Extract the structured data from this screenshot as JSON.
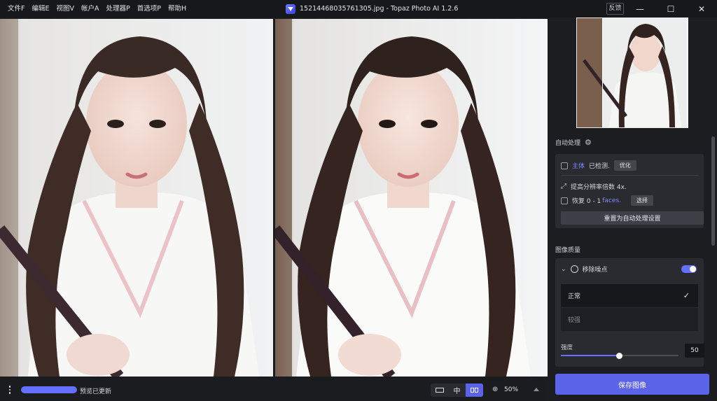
{
  "menu": [
    "文件F",
    "编辑E",
    "视图V",
    "帐户A",
    "处理器P",
    "首选项P",
    "帮助H"
  ],
  "window": {
    "title": "15214468035761305.jpg - Topaz Photo AI 1.2.6",
    "feedback": "反馈",
    "minimize_glyph": "—",
    "maximize_glyph": "☐",
    "close_glyph": "✕"
  },
  "autopilot": {
    "heading": "自动处理",
    "subject_label": "主体",
    "subject_status": "已检测.",
    "optimize_button": "优化",
    "upscale_text": "提高分辨率倍数 4x.",
    "recover_prefix": "恢复 0 - 1",
    "recover_faces": "faces.",
    "select_button": "选择",
    "reset_button": "重置为自动处理设置"
  },
  "image_quality": {
    "heading": "图像质量",
    "denoise_label": "移除噪点",
    "denoise_enabled": true,
    "options": [
      "正常",
      "较强"
    ],
    "selected_option": "正常",
    "strength_label": "强度",
    "strength_value": "50"
  },
  "save_button": "保存图像",
  "bottom": {
    "progress": 1.0,
    "status": "预览已更新",
    "view_modes": [
      "single",
      "side-by-side-center",
      "split"
    ],
    "active_view": "split",
    "center_label": "中",
    "zoom": "50%"
  },
  "colors": {
    "accent": "#5b63e8",
    "panel": "#1c1d21",
    "card": "#2a2b31"
  }
}
